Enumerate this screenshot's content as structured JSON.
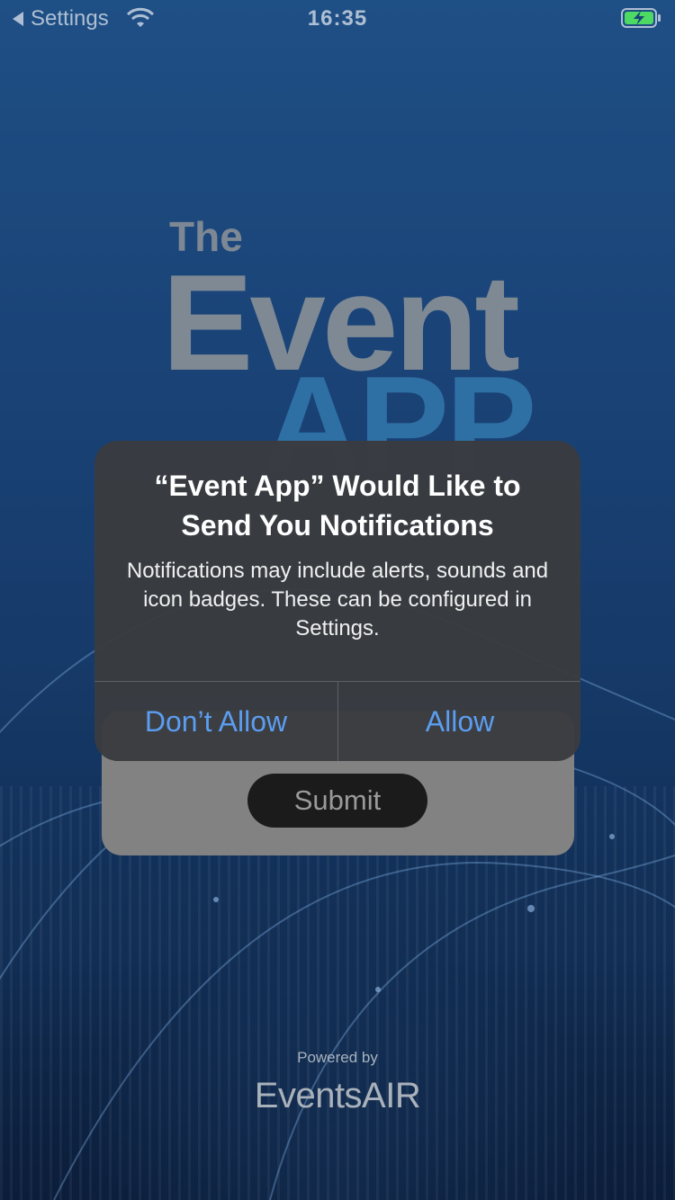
{
  "status_bar": {
    "back_label": "Settings",
    "time": "16:35",
    "icons": [
      "back-arrow-icon",
      "wifi-icon",
      "battery-charging-icon"
    ],
    "battery_color": "#4cd964"
  },
  "logo": {
    "line1": "The",
    "line2": "Event",
    "line3": "APP"
  },
  "form": {
    "submit_label": "Submit"
  },
  "alert": {
    "title": "“Event App” Would Like to Send You Notifications",
    "message": "Notifications may include alerts, sounds and icon badges. These can be configured in Settings.",
    "deny_label": "Don’t Allow",
    "allow_label": "Allow",
    "button_color": "#5b9df0"
  },
  "footer": {
    "powered_by": "Powered by",
    "brand": "EventsAIR"
  }
}
